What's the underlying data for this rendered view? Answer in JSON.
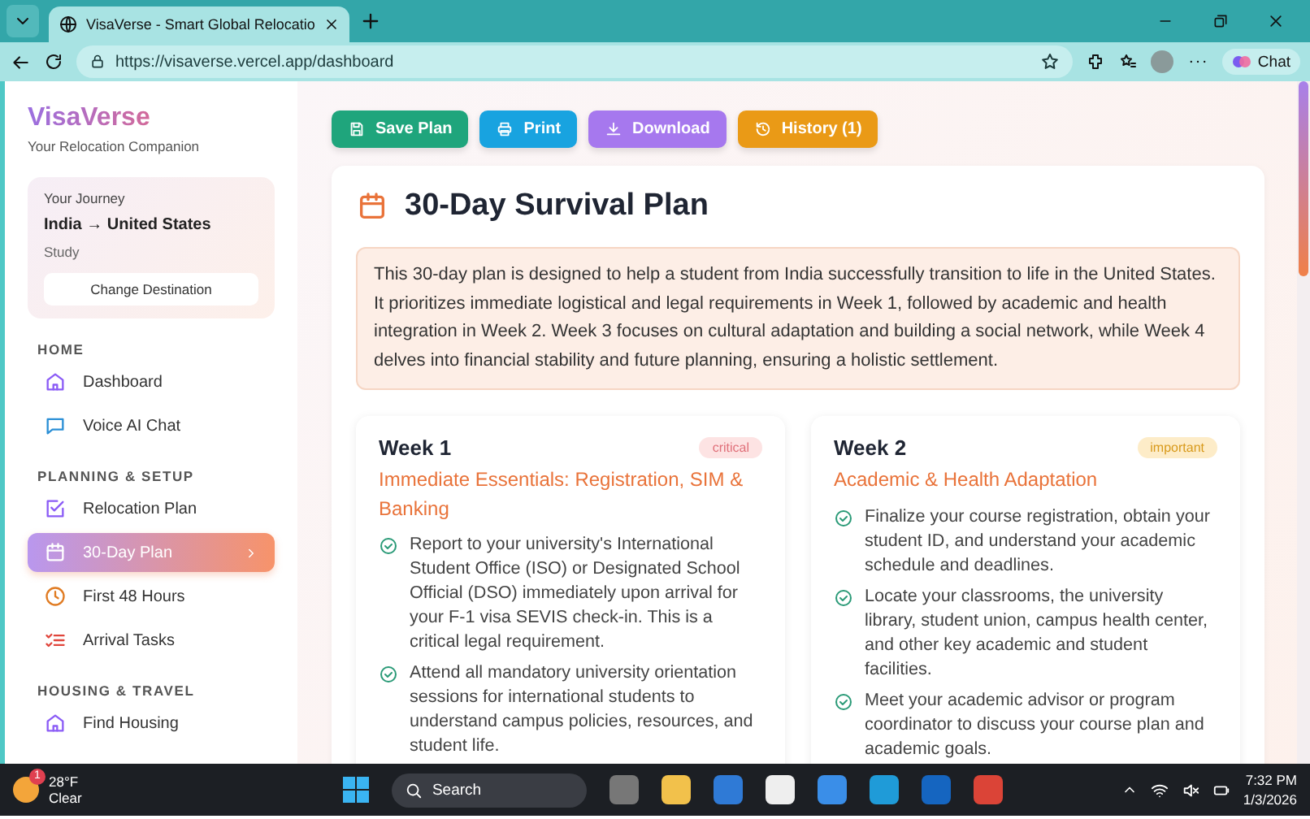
{
  "browser": {
    "tab_title": "VisaVerse - Smart Global Relocatio",
    "url": "https://visaverse.vercel.app/dashboard",
    "chat_label": "Chat"
  },
  "sidebar": {
    "brand": "VisaVerse",
    "tagline": "Your Relocation Companion",
    "journey": {
      "label": "Your Journey",
      "route": "India → United States",
      "purpose": "Study",
      "button": "Change Destination"
    },
    "sections": [
      {
        "heading": "HOME",
        "items": [
          {
            "label": "Dashboard",
            "kind": "home",
            "selected": false
          },
          {
            "label": "Voice AI Chat",
            "kind": "chat",
            "selected": false
          }
        ]
      },
      {
        "heading": "PLANNING & SETUP",
        "items": [
          {
            "label": "Relocation Plan",
            "kind": "check",
            "selected": false
          },
          {
            "label": "30-Day Plan",
            "kind": "calendar",
            "selected": true
          },
          {
            "label": "First 48 Hours",
            "kind": "clock",
            "selected": false
          },
          {
            "label": "Arrival Tasks",
            "kind": "list",
            "selected": false
          }
        ]
      },
      {
        "heading": "HOUSING & TRAVEL",
        "items": [
          {
            "label": "Find Housing",
            "kind": "home",
            "selected": false
          }
        ]
      }
    ]
  },
  "toolbar": [
    {
      "label": "Save Plan",
      "kind": "save",
      "color": "#1fa57c"
    },
    {
      "label": "Print",
      "kind": "print",
      "color": "#18a3e0"
    },
    {
      "label": "Download",
      "kind": "download",
      "color": "#a678ee"
    },
    {
      "label": "History (1)",
      "kind": "history",
      "color": "#ea9a16"
    }
  ],
  "plan": {
    "title": "30-Day Survival Plan",
    "summary": "This 30-day plan is designed to help a student from India successfully transition to life in the United States. It prioritizes immediate logistical and legal requirements in Week 1, followed by academic and health integration in Week 2. Week 3 focuses on cultural adaptation and building a social network, while Week 4 delves into financial stability and future planning, ensuring a holistic settlement.",
    "weeks": [
      {
        "title": "Week 1",
        "badge": "critical",
        "kind": "critical",
        "subtitle": "Immediate Essentials: Registration, SIM & Banking",
        "tasks": [
          "Report to your university's International Student Office (ISO) or Designated School Official (DSO) immediately upon arrival for your F-1 visa SEVIS check-in. This is a critical legal requirement.",
          "Attend all mandatory university orientation sessions for international students to understand campus policies, resources, and student life."
        ]
      },
      {
        "title": "Week 2",
        "badge": "important",
        "kind": "important",
        "subtitle": "Academic & Health Adaptation",
        "tasks": [
          "Finalize your course registration, obtain your student ID, and understand your academic schedule and deadlines.",
          "Locate your classrooms, the university library, student union, campus health center, and other key academic and student facilities.",
          "Meet your academic advisor or program coordinator to discuss your course plan and academic goals."
        ]
      }
    ]
  },
  "taskbar": {
    "temperature": "28°F",
    "condition": "Clear",
    "weather_badge": "1",
    "search": "Search",
    "time": "7:32 PM",
    "date": "1/3/2026"
  }
}
